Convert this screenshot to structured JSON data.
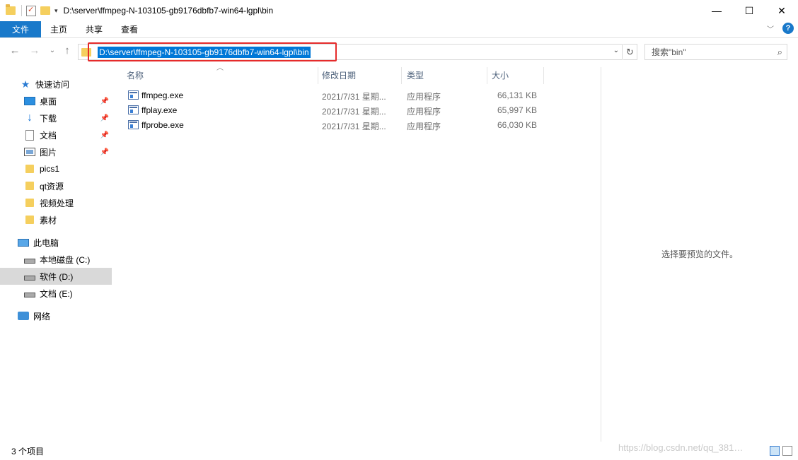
{
  "window": {
    "title": "D:\\server\\ffmpeg-N-103105-gb9176dbfb7-win64-lgpl\\bin",
    "min_glyph": "—",
    "max_glyph": "☐",
    "close_glyph": "✕"
  },
  "ribbon": {
    "tabs": [
      "文件",
      "主页",
      "共享",
      "查看"
    ],
    "help": "?"
  },
  "address": {
    "path": "D:\\server\\ffmpeg-N-103105-gb9176dbfb7-win64-lgpl\\bin",
    "search_placeholder": "搜索\"bin\""
  },
  "sidebar": {
    "quick_access": "快速访问",
    "items": [
      {
        "label": "桌面",
        "icon": "desktop-icon",
        "pinned": true
      },
      {
        "label": "下载",
        "icon": "download-icon",
        "pinned": true
      },
      {
        "label": "文档",
        "icon": "document-icon",
        "pinned": true
      },
      {
        "label": "图片",
        "icon": "picture-icon",
        "pinned": true
      },
      {
        "label": "pics1",
        "icon": "folder-icon",
        "pinned": false
      },
      {
        "label": "qt资源",
        "icon": "folder-icon",
        "pinned": false
      },
      {
        "label": "视频处理",
        "icon": "folder-icon",
        "pinned": false
      },
      {
        "label": "素材",
        "icon": "folder-icon",
        "pinned": false
      }
    ],
    "this_pc": "此电脑",
    "drives": [
      {
        "label": "本地磁盘 (C:)",
        "selected": false
      },
      {
        "label": "软件 (D:)",
        "selected": true
      },
      {
        "label": "文档 (E:)",
        "selected": false
      }
    ],
    "network": "网络"
  },
  "columns": {
    "name": "名称",
    "modified": "修改日期",
    "type": "类型",
    "size": "大小"
  },
  "files": [
    {
      "name": "ffmpeg.exe",
      "modified": "2021/7/31 星期...",
      "type": "应用程序",
      "size": "66,131 KB"
    },
    {
      "name": "ffplay.exe",
      "modified": "2021/7/31 星期...",
      "type": "应用程序",
      "size": "65,997 KB"
    },
    {
      "name": "ffprobe.exe",
      "modified": "2021/7/31 星期...",
      "type": "应用程序",
      "size": "66,030 KB"
    }
  ],
  "preview": {
    "message": "选择要预览的文件。"
  },
  "status": {
    "item_count": "3 个项目",
    "watermark": "https://blog.csdn.net/qq_381…"
  }
}
